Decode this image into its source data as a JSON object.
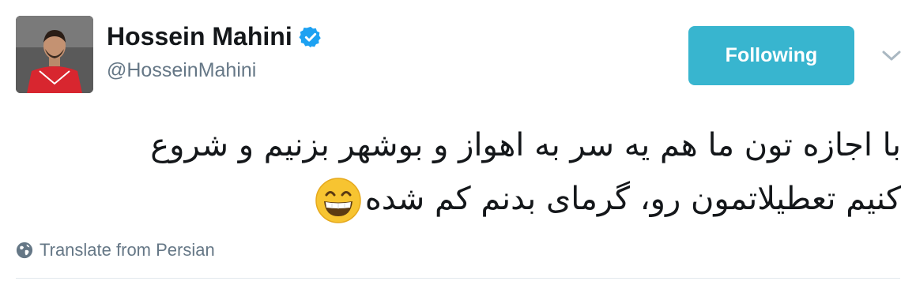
{
  "user": {
    "display_name": "Hossein Mahini",
    "handle": "@HosseinMahini",
    "verified": true,
    "avatar_icon": "profile-photo-footballer"
  },
  "actions": {
    "follow_label": "Following",
    "follow_color": "#38b5cf",
    "more_icon": "chevron-down-icon"
  },
  "tweet": {
    "line1": "با اجازه تون ما هم یه سر به اهواز و بوشهر بزنیم و شروع",
    "line2": "کنیم تعطیلاتمون رو، گرمای بدنم کم شده",
    "emoji": "grinning-face-with-smiling-eyes"
  },
  "translate": {
    "label": "Translate from Persian",
    "icon": "globe-icon"
  }
}
